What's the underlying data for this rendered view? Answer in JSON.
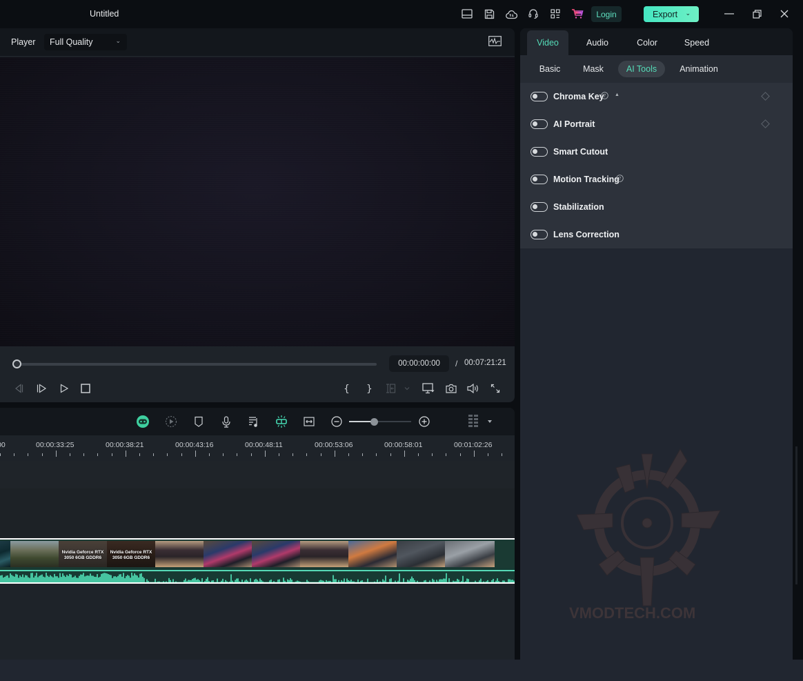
{
  "titlebar": {
    "title": "Untitled",
    "icons": [
      "layout-icon",
      "save-icon",
      "cloud-upload-icon",
      "headset-icon",
      "grid-apps-icon",
      "cart-icon"
    ],
    "login_label": "Login",
    "export_label": "Export",
    "colors": {
      "accent": "#45e6c2",
      "cart": "#e64aa0"
    }
  },
  "player": {
    "label": "Player",
    "quality": "Full Quality",
    "current_time": "00:00:00:00",
    "separator": "/",
    "total_time": "00:07:21:21",
    "progress": 0
  },
  "timeline": {
    "zoom_level": 0.4,
    "ruler_labels": [
      "00",
      "00:00:33:25",
      "00:00:38:21",
      "00:00:43:16",
      "00:00:48:11",
      "00:00:53:06",
      "00:00:58:01",
      "00:01:02:26"
    ],
    "thumbnails": [
      {
        "kind": "game-neon",
        "caption": ""
      },
      {
        "kind": "game-street",
        "caption": ""
      },
      {
        "kind": "title-card",
        "caption": "Nvidia Geforce RTX 3050 6GB GDDR6"
      },
      {
        "kind": "title-card-dark",
        "caption": "Nvidia Geforce RTX 3050 6GB GDDR6"
      },
      {
        "kind": "laptop-keyboard",
        "caption": ""
      },
      {
        "kind": "laptop-screen",
        "caption": ""
      },
      {
        "kind": "laptop-screen",
        "caption": ""
      },
      {
        "kind": "laptop-keyboard",
        "caption": ""
      },
      {
        "kind": "laptop-screen-orange",
        "caption": ""
      },
      {
        "kind": "laptop-lid",
        "caption": ""
      },
      {
        "kind": "laptop-lid-light",
        "caption": ""
      }
    ]
  },
  "properties": {
    "tabs": [
      {
        "label": "Video",
        "active": true
      },
      {
        "label": "Audio",
        "active": false
      },
      {
        "label": "Color",
        "active": false
      },
      {
        "label": "Speed",
        "active": false
      }
    ],
    "subtabs": [
      {
        "label": "Basic",
        "active": false
      },
      {
        "label": "Mask",
        "active": false
      },
      {
        "label": "AI Tools",
        "active": true
      },
      {
        "label": "Animation",
        "active": false
      }
    ],
    "ai_tools": [
      {
        "label": "Chroma Key",
        "enabled": false,
        "help": true,
        "keyframe": true,
        "expand": true
      },
      {
        "label": "AI Portrait",
        "enabled": false,
        "help": false,
        "keyframe": true,
        "expand": false
      },
      {
        "label": "Smart Cutout",
        "enabled": false,
        "help": false,
        "keyframe": false,
        "expand": false
      },
      {
        "label": "Motion Tracking",
        "enabled": false,
        "help": true,
        "keyframe": false,
        "expand": false
      },
      {
        "label": "Stabilization",
        "enabled": false,
        "help": false,
        "keyframe": false,
        "expand": false
      },
      {
        "label": "Lens Correction",
        "enabled": false,
        "help": false,
        "keyframe": false,
        "expand": false
      }
    ]
  },
  "watermark": {
    "text": "VMODTECH.COM"
  }
}
